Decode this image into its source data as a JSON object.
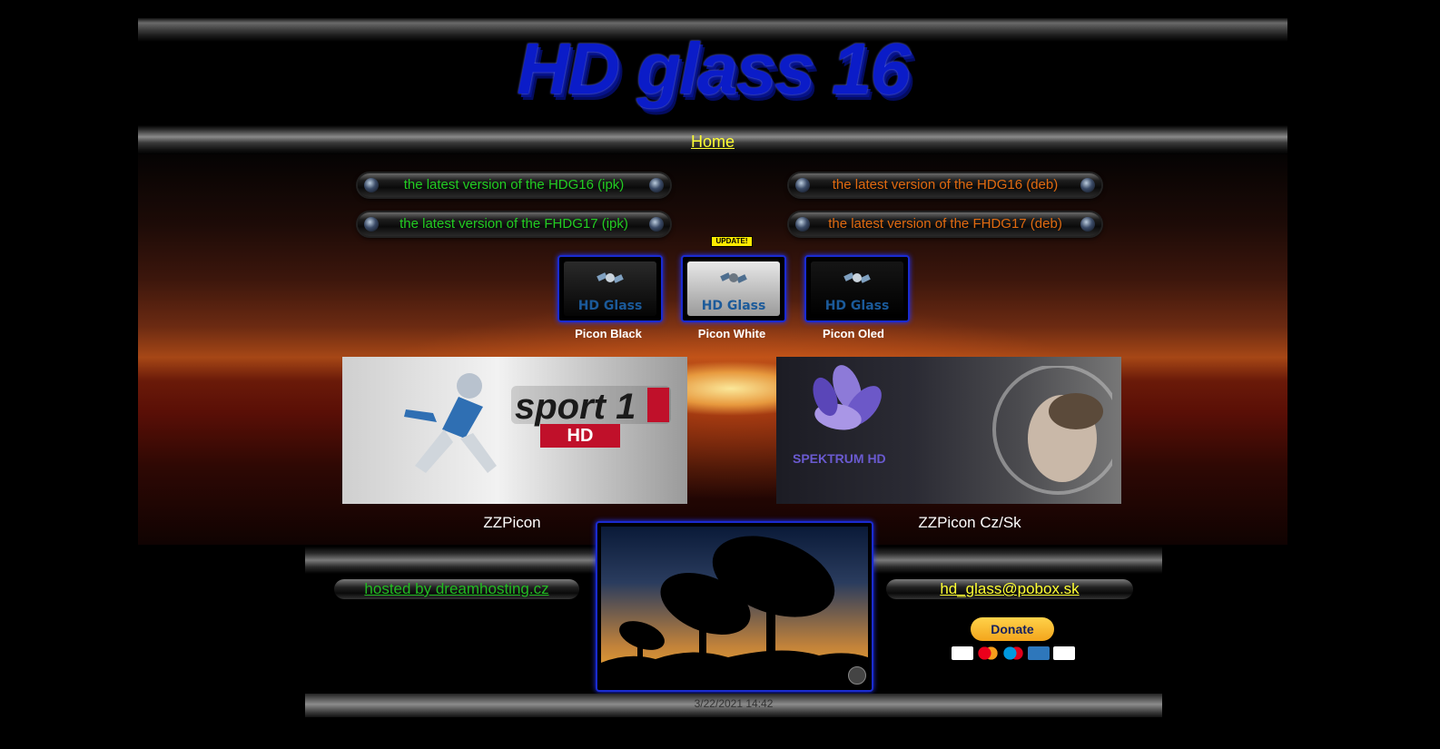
{
  "site": {
    "title": "HD glass 16",
    "nav": {
      "home_label": "Home"
    }
  },
  "downloads": [
    {
      "label": "the latest version of the HDG16 (ipk)",
      "color": "#22cc22"
    },
    {
      "label": "the latest version of the HDG16 (deb)",
      "color": "#e06a10"
    },
    {
      "label": "the latest version of the FHDG17 (ipk)",
      "color": "#22cc22"
    },
    {
      "label": "the latest version of the FHDG17 (deb)",
      "color": "#e06a10"
    }
  ],
  "update_badge": "UPDATE!",
  "picons": [
    {
      "brand": "HD Glass",
      "label": "Picon Black"
    },
    {
      "brand": "HD Glass",
      "label": "Picon White"
    },
    {
      "brand": "HD Glass",
      "label": "Picon Oled"
    }
  ],
  "panels": [
    {
      "caption": "ZZPicon",
      "logo_text": "sport 1",
      "badge": "HD"
    },
    {
      "caption": "ZZPicon Cz/Sk",
      "logo_text": "SPEKTRUM HD"
    }
  ],
  "footer": {
    "host_link": "hosted by dreamhosting.cz",
    "email_link": "hd_glass@pobox.sk",
    "donate_label": "Donate",
    "payment_cards": [
      "visa-icon",
      "mastercard-icon",
      "maestro-icon",
      "amex-icon",
      "discover-icon"
    ],
    "timestamp": "3/22/2021 14:42"
  },
  "colors": {
    "accent_blue": "#1a2bd0",
    "link_yellow": "#ffff33",
    "link_green": "#22bb22"
  }
}
